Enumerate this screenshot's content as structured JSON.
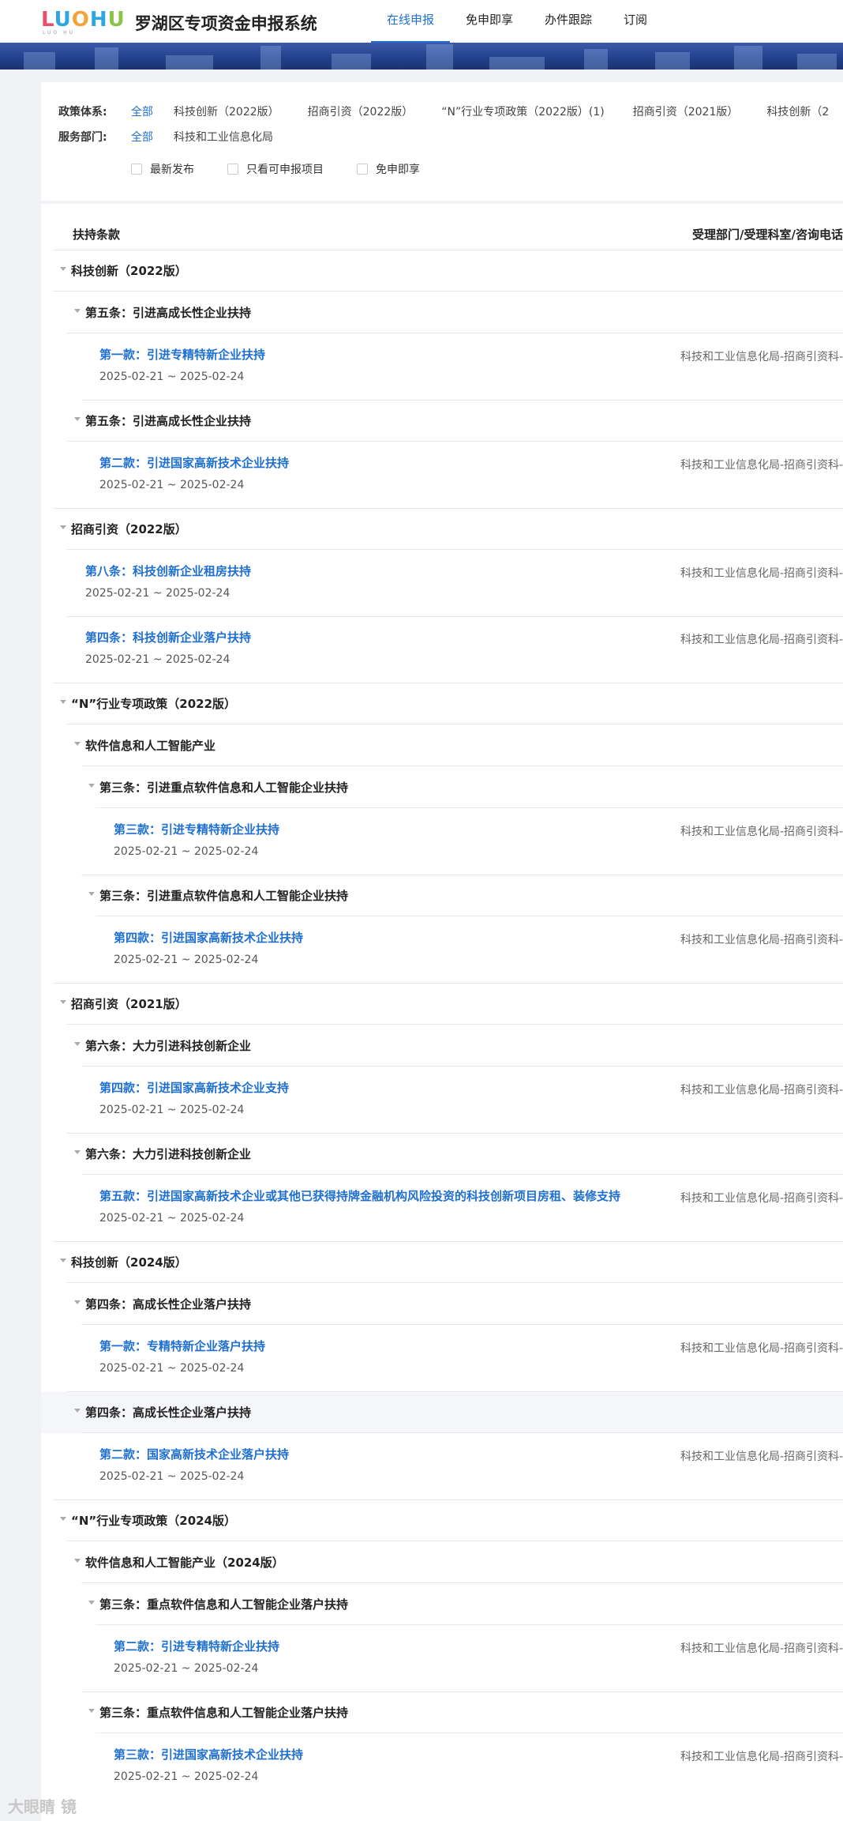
{
  "header": {
    "logo_text": "LUOHU",
    "logo_sub": "LUO HU",
    "system_title": "罗湖区专项资金申报系统",
    "nav": [
      "在线申报",
      "免申即享",
      "办件跟踪",
      "订阅"
    ]
  },
  "filters": {
    "policy_label": "政策体系:",
    "policy_options": [
      "全部",
      "科技创新（2022版）",
      "招商引资（2022版）",
      "“N”行业专项政策（2022版）(1)",
      "招商引资（2021版）",
      "科技创新（2"
    ],
    "dept_label": "服务部门:",
    "dept_options": [
      "全部",
      "科技和工业信息化局"
    ],
    "checks": [
      "最新发布",
      "只看可申报项目",
      "免申即享"
    ]
  },
  "table": {
    "col_clause": "扶持条款",
    "col_dept": "受理部门/受理科室/咨询电话",
    "dept_text": "科技和工业信息化局-招商引资科-",
    "date_range": "2025-02-21 ~ 2025-02-24",
    "groups": [
      "科技创新（2022版）",
      "第五条：引进高成长性企业扶持",
      "招商引资（2022版）",
      "“N”行业专项政策（2022版）",
      "软件信息和人工智能产业",
      "第三条：引进重点软件信息和人工智能企业扶持",
      "招商引资（2021版）",
      "第六条：大力引进科技创新企业",
      "科技创新（2024版）",
      "第四条：高成长性企业落户扶持",
      "“N”行业专项政策（2024版）",
      "软件信息和人工智能产业（2024版）",
      "第三条：重点软件信息和人工智能企业落户扶持"
    ],
    "items": [
      "第一款：引进专精特新企业扶持",
      "第二款：引进国家高新技术企业扶持",
      "第八条：科技创新企业租房扶持",
      "第四条：科技创新企业落户扶持",
      "第三款：引进专精特新企业扶持",
      "第四款：引进国家高新技术企业扶持",
      "第四款：引进国家高新技术企业支持",
      "第五款：引进国家高新技术企业或其他已获得持牌金融机构风险投资的科技创新项目房租、装修支持",
      "第一款：专精特新企业落户扶持",
      "第二款：国家高新技术企业落户扶持",
      "第二款：引进专精特新企业扶持",
      "第三款：引进国家高新技术企业扶持"
    ]
  },
  "watermark": "大眼睛 镜"
}
